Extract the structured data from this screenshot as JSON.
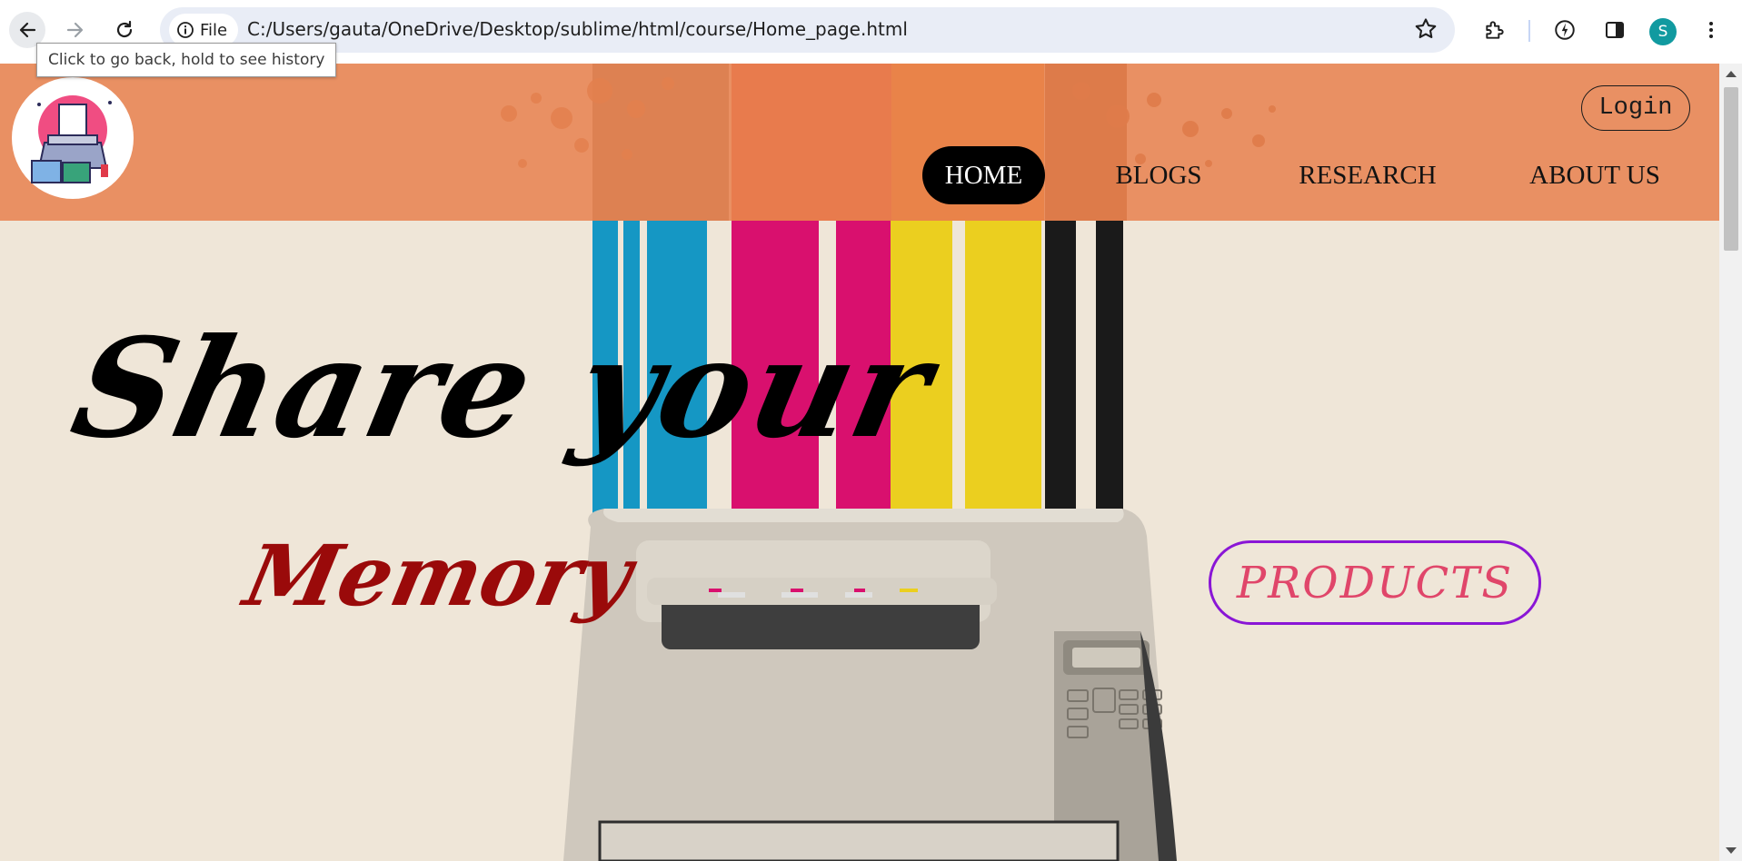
{
  "browser": {
    "site_chip_label": "File",
    "url": "C:/Users/gauta/OneDrive/Desktop/sublime/html/course/Home_page.html",
    "tooltip": "Click to go back, hold to see history",
    "profile_initial": "S",
    "icons": [
      "back-arrow-icon",
      "forward-arrow-icon",
      "reload-icon",
      "info-icon",
      "star-icon",
      "extensions-icon",
      "performance-icon",
      "side-panel-icon",
      "kebab-menu-icon"
    ]
  },
  "header": {
    "login_label": "Login",
    "nav": [
      {
        "label": "HOME",
        "active": true
      },
      {
        "label": "BLOGS",
        "active": false
      },
      {
        "label": "RESEARCH",
        "active": false
      },
      {
        "label": "ABOUT US",
        "active": false
      }
    ],
    "band_color": "#e8844f"
  },
  "hero": {
    "headline": "Share your",
    "subline": "Memory",
    "products_label": "PRODUCTS",
    "colors": {
      "cyan": "#1597c4",
      "magenta": "#d9106e",
      "yellow": "#ebcf1f",
      "black": "#1a1a1a",
      "red": "#e03a2a",
      "orange": "#e9790e",
      "memory_red": "#9a0a0a",
      "products_border": "#8a16d6",
      "products_text": "#e0466a"
    }
  }
}
